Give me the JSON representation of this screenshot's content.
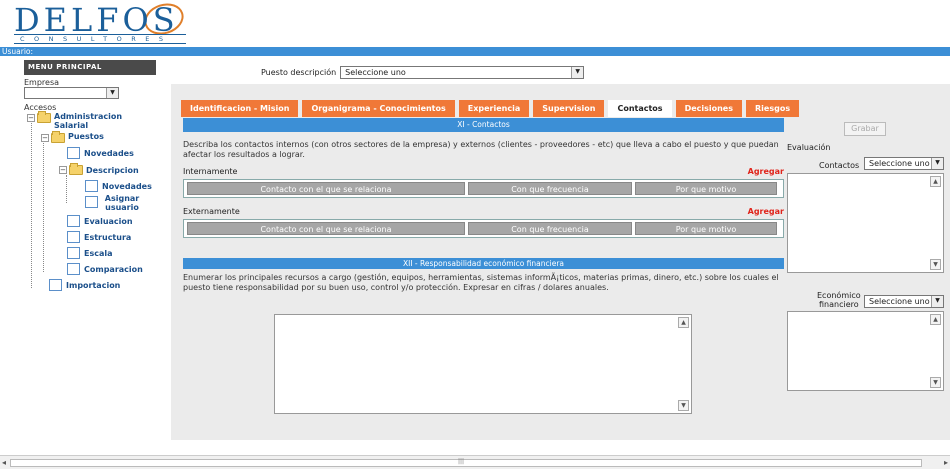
{
  "logo": {
    "main": "DELFOS",
    "sub": "CONSULTORES"
  },
  "userbar": {
    "label": "Usuario:"
  },
  "sidebar": {
    "menu_title": "MENU PRINCIPAL",
    "empresa_label": "Empresa",
    "empresa_value": "",
    "accesos_label": "Accesos",
    "tree": {
      "administracion": "Administracion Salarial",
      "puestos": "Puestos",
      "novedades": "Novedades",
      "descripcion": "Descripcion",
      "desc_novedades": "Novedades",
      "asignar_usuario": "Asignar usuario",
      "evaluacion": "Evaluacion",
      "estructura": "Estructura",
      "escala": "Escala",
      "comparacion": "Comparacion",
      "importacion": "Importacion"
    }
  },
  "puesto": {
    "label": "Puesto descripción",
    "value": "Seleccione uno"
  },
  "tabs": [
    {
      "label": "Identificacion - Mision"
    },
    {
      "label": "Organigrama - Conocimientos"
    },
    {
      "label": "Experiencia"
    },
    {
      "label": "Supervision"
    },
    {
      "label": "Contactos",
      "active": true
    },
    {
      "label": "Decisiones"
    },
    {
      "label": "Riesgos"
    }
  ],
  "contactos": {
    "section_title": "XI - Contactos",
    "description": "Describa los contactos internos (con otros sectores de la empresa) y externos (clientes - proveedores - etc) que lleva a cabo el puesto y que puedan afectar los resultados a lograr.",
    "internamente_label": "Internamente",
    "externamente_label": "Externamente",
    "agregar_label": "Agregar",
    "columns": [
      "Contacto con el que se relaciona",
      "Con que frecuencia",
      "Por que motivo"
    ]
  },
  "responsabilidad": {
    "section_title": "XII - Responsabilidad económico financiera",
    "description": "Enumerar los principales recursos a cargo (gestión, equipos, herramientas, sistemas informÃ¡ticos, materias primas, dinero, etc.) sobre los cuales el puesto tiene responsabilidad por su buen uso, control y/o protección. Expresar en cifras / dolares anuales."
  },
  "right": {
    "grabar_label": "Grabar",
    "evaluacion_label": "Evaluación",
    "contactos_label": "Contactos",
    "contactos_value": "Seleccione uno",
    "economico_label_1": "Económico",
    "economico_label_2": "financiero",
    "economico_value": "Seleccione uno"
  },
  "colors": {
    "accent_blue": "#3c8fd6",
    "tab_orange": "#f07838",
    "agregar_red": "#e0241b"
  }
}
